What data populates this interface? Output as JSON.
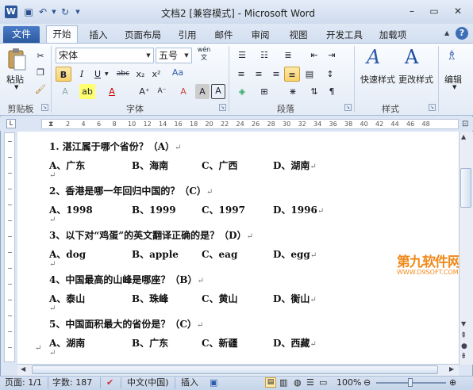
{
  "window": {
    "title": "文档2 [兼容模式] - Microsoft Word",
    "qat": {
      "save_icon": "save-icon",
      "undo_icon": "undo-icon",
      "redo_icon": "redo-icon"
    },
    "controls": {
      "minimize": "–",
      "maximize": "▭",
      "close": "✕"
    }
  },
  "tabs": {
    "file": "文件",
    "items": [
      "开始",
      "插入",
      "页面布局",
      "引用",
      "邮件",
      "审阅",
      "视图",
      "开发工具",
      "加载项"
    ],
    "active": "开始"
  },
  "ribbon": {
    "clipboard": {
      "label": "剪贴板",
      "paste": "粘贴"
    },
    "font": {
      "label": "字体",
      "font_name": "宋体",
      "font_size": "五号",
      "wen_glyph": "wén\n文",
      "bold": "B",
      "italic": "I",
      "underline": "U",
      "strike": "abc",
      "sub": "x₂",
      "sup": "x²",
      "grow": "A⁺",
      "shrink": "A⁻",
      "aa": "Aa",
      "clear": "A",
      "a_char": "A"
    },
    "paragraph": {
      "label": "段落"
    },
    "styles": {
      "label": "样式",
      "quick": "快速样式",
      "change": "更改样式"
    },
    "editing": {
      "label": "编辑"
    }
  },
  "ruler": {
    "ticks": [
      "2",
      "4",
      "6",
      "8",
      "10",
      "12",
      "14",
      "16",
      "18",
      "20",
      "22",
      "24",
      "26",
      "28",
      "30",
      "32",
      "34",
      "36",
      "38",
      "40",
      "42",
      "44",
      "46",
      "48"
    ],
    "left_label": "L"
  },
  "document": {
    "questions": [
      {
        "text": "1.  湛江属于哪个省份？（A）",
        "options": [
          "A、广东",
          "B、海南",
          "C、广西",
          "D、湖南"
        ]
      },
      {
        "text": "2、香港是哪一年回归中国的？（C）",
        "options": [
          "A、1998",
          "B、1999",
          "C、1997",
          "D、1996"
        ]
      },
      {
        "text": "3、以下对“鸡蛋”的英文翻译正确的是？（D）",
        "options": [
          "A、dog",
          "B、apple",
          "C、eag",
          "D、egg"
        ]
      },
      {
        "text": "4、中国最高的山峰是哪座？（B）",
        "options": [
          "A、泰山",
          "B、珠峰",
          "C、黄山",
          "D、衡山"
        ]
      },
      {
        "text": "5、中国面积最大的省份是？（C）",
        "options": [
          "A、湖南",
          "B、广东",
          "C、新疆",
          "D、西藏"
        ]
      }
    ],
    "para_mark": "↵"
  },
  "watermark": {
    "line1": "第九软件网",
    "line2": "WWW.D9SOFT.COM"
  },
  "status": {
    "page": "页面: 1/1",
    "words": "字数: 187",
    "language": "中文(中国)",
    "mode": "插入",
    "zoom": "100%"
  }
}
